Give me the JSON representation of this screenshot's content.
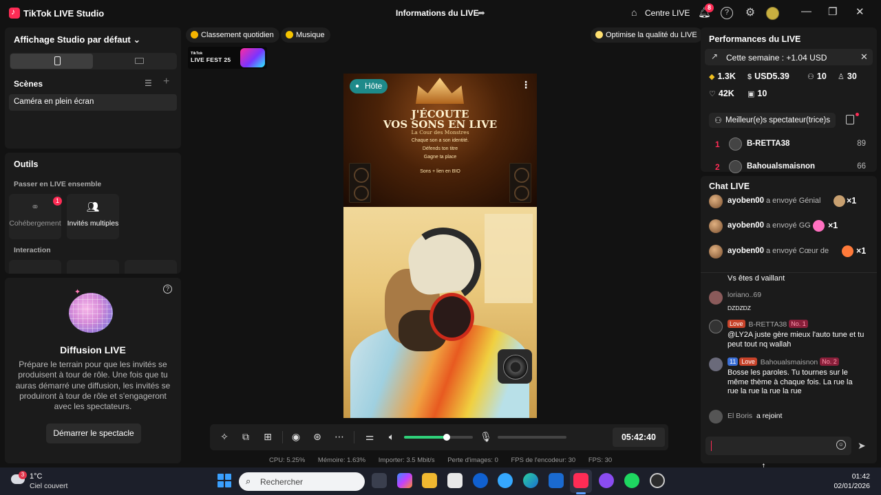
{
  "app": {
    "name": "TikTok LIVE Studio"
  },
  "header": {
    "live_info": "Informations du LIVE",
    "centre_live": "Centre LIVE",
    "notif_count": "8"
  },
  "left": {
    "studio_title": "Affichage Studio par défaut",
    "scenes_title": "Scènes",
    "scene_item": "Caméra en plein écran",
    "outils_title": "Outils",
    "passer_label": "Passer en LIVE ensemble",
    "tools": [
      {
        "label": "Cohébergement",
        "badge": "1"
      },
      {
        "label": "Invités multiples"
      }
    ],
    "interaction_label": "Interaction",
    "diffusion": {
      "title": "Diffusion LIVE",
      "desc": "Prépare le terrain pour que les invités se produisent à tour de rôle. Une fois que tu auras démarré une diffusion, les invités se produiront à tour de rôle et s'engageront avec les spectateurs.",
      "button": "Démarrer le spectacle"
    }
  },
  "center": {
    "pills": {
      "classement": "Classement quotidien",
      "musique": "Musique",
      "optimise": "Optimise la qualité du LIVE"
    },
    "livefest": {
      "line1": "TikTok",
      "line2": "LIVE FEST 25"
    },
    "video": {
      "host_label": "Hôte",
      "poster": {
        "line1": "J'ÉCOUTE",
        "line2": "VOS SONS EN LIVE",
        "line3": "La Cour des Monstres",
        "bullets": [
          "Chaque son a son identité.",
          "Défends ton titre",
          "Gagne ta place",
          "Sons + lien en BIO"
        ]
      }
    },
    "controls": {
      "timer": "05:42:40",
      "volume_level": 0.62
    },
    "stats": {
      "cpu": "CPU:  5.25%",
      "mem": "Mémoire:  1.63%",
      "import": "Importer:  3.5 Mbit/s",
      "loss": "Perte d'images:  0",
      "enc_fps": "FPS de l'encodeur:  30",
      "fps": "FPS:  30"
    }
  },
  "right": {
    "perf_title": "Performances du LIVE",
    "week": "Cette semaine : +1.04 USD",
    "stats": {
      "diamonds": "1.3K",
      "usd": "USD5.39",
      "users": "10",
      "followers": "30",
      "likes": "42K",
      "gifters": "10"
    },
    "top_button": "Meilleur(e)s spectateur(trice)s",
    "ranking": [
      {
        "rank": "1",
        "name": "B-RETTA38",
        "score": "89"
      },
      {
        "rank": "2",
        "name": "Bahoualsmaisnon",
        "score": "66"
      }
    ],
    "chat": {
      "title": "Chat LIVE",
      "gifts": [
        {
          "user": "ayoben00",
          "action": "a envoyé Génial",
          "count": "×1"
        },
        {
          "user": "ayoben00",
          "action": "a envoyé GG",
          "count": "×1"
        },
        {
          "user": "ayoben00",
          "action": "a envoyé Cœur de",
          "count": "×1"
        }
      ],
      "partial_text": "Vs êtes d vaillant",
      "messages": [
        {
          "user": "loriano..69",
          "text": "DZDZDZ"
        },
        {
          "tags": [
            "Love"
          ],
          "user": "B-RETTA38",
          "rank": "No. 1",
          "text": "@LY2A juste gère mieux l'auto tune et tu peut tout nq wallah"
        },
        {
          "level": "11",
          "tags": [
            "Love"
          ],
          "user": "Bahoualsmaisnon",
          "rank": "No. 2",
          "text": "Bosse les paroles. Tu tournes sur le même thème à chaque fois. La rue la rue la rue la rue la rue"
        },
        {
          "user": "El Boris",
          "text": "a rejoint"
        }
      ]
    }
  },
  "taskbar": {
    "weather_temp": "1°C",
    "weather_desc": "Ciel couvert",
    "weather_badge": "3",
    "search": "Rechercher",
    "time": "01:42",
    "date": "02/01/2026"
  }
}
